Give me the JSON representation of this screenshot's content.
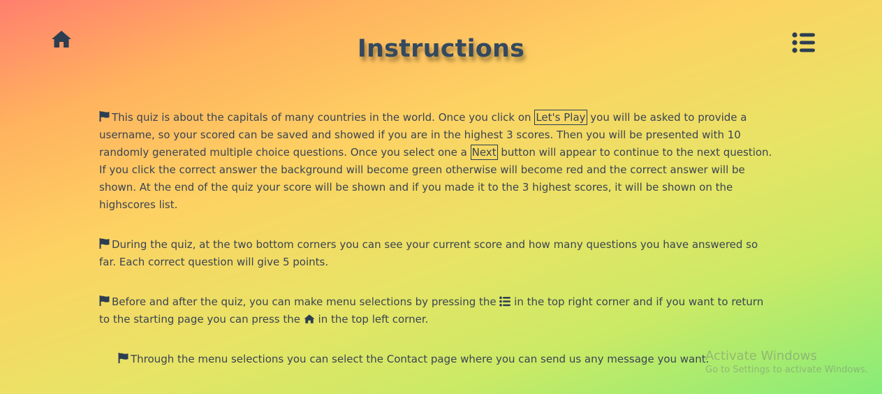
{
  "page": {
    "title": "Instructions"
  },
  "nav": {
    "home_icon": "home-icon",
    "menu_icon": "list-icon"
  },
  "instructions": {
    "p1": {
      "a": "This quiz is about the capitals of many countries in the world. Once you click on ",
      "btn_lets_play": "Let's Play",
      "b": " you will be asked to provide a username, so your scored can be saved and showed if you are in the highest 3 scores. Then you will be presented with 10 randomly generated multiple choice questions. Once you select one a ",
      "btn_next": "Next",
      "c": " button will appear to continue to the next question. If you click the correct answer the background will become green otherwise will become red and the correct answer will be shown. At the end of the quiz your score will be shown and if you made it to the 3 highest scores, it will be shown on the highscores list."
    },
    "p2": "During the quiz, at the two bottom corners you can see your current score and how many questions you have answered so far. Each correct question will give 5 points.",
    "p3": {
      "a": "Before and after the quiz, you can make menu selections by pressing the ",
      "b": " in the top right corner and if you want to return to the starting page you can press the ",
      "c": " in the top left corner."
    },
    "p4": "Through the menu selections you can select the Contact page where you can send us any message you want."
  },
  "watermark": {
    "line1": "Activate Windows",
    "line2": "Go to Settings to activate Windows."
  },
  "colors": {
    "text": "#2c3e50",
    "gradient_start": "#ff7f6e",
    "gradient_end": "#86ec78"
  }
}
